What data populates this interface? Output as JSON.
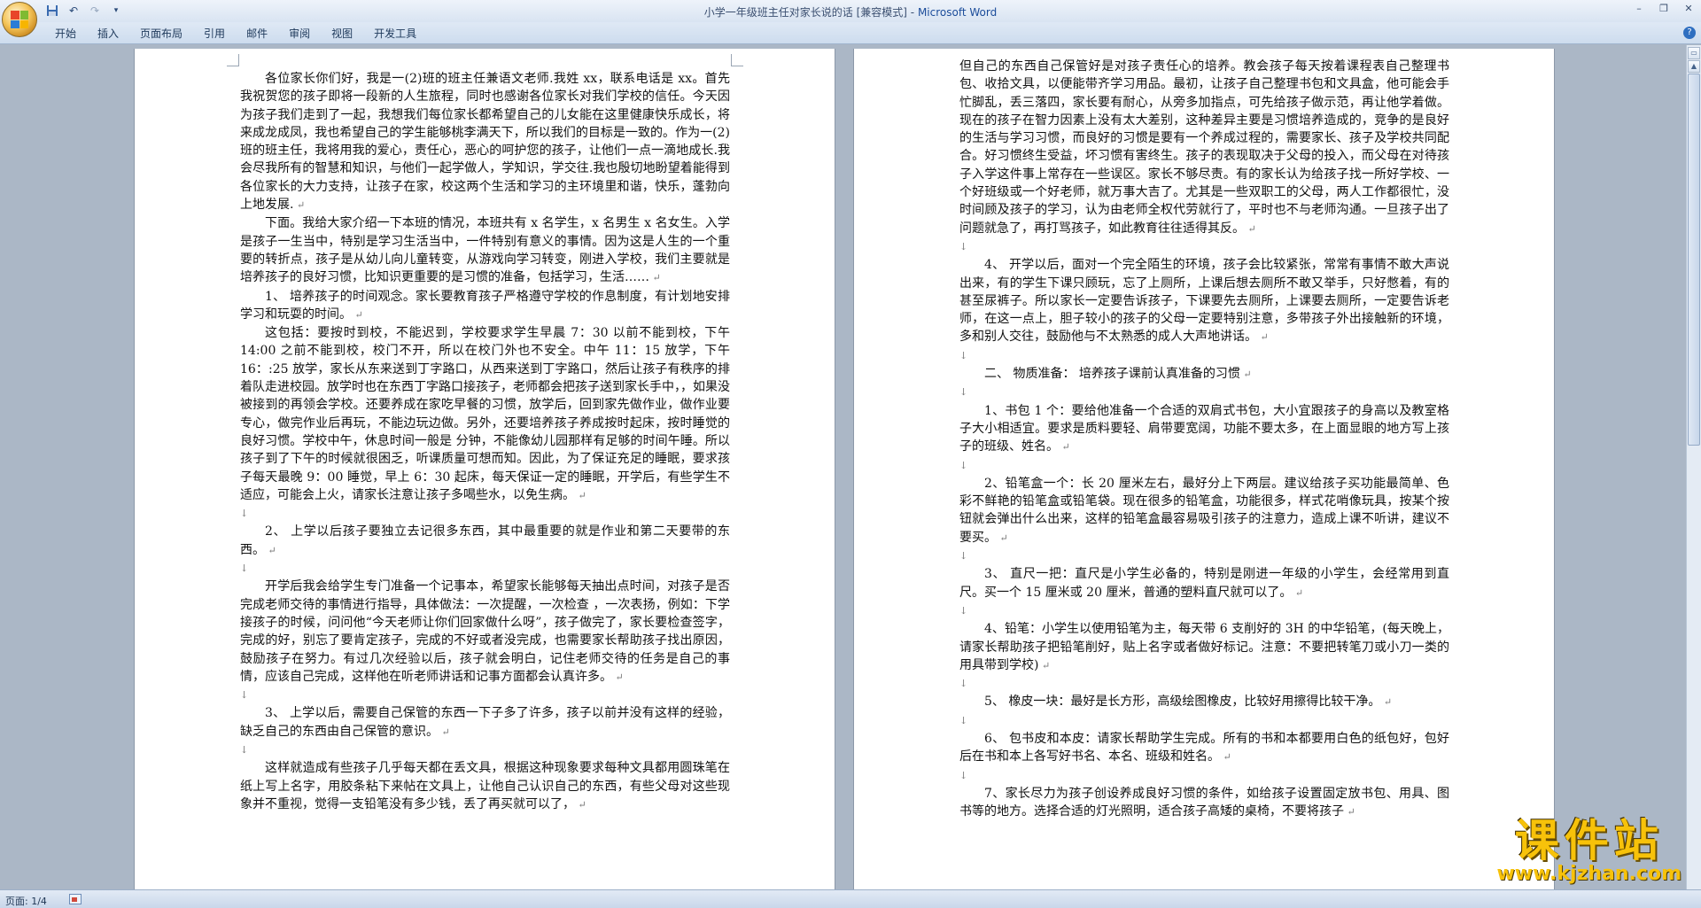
{
  "window": {
    "document_title": "小学一年级班主任对家长说的话 [兼容模式]",
    "separator": " - ",
    "app_name": "Microsoft Word"
  },
  "ribbon": {
    "tabs": [
      "开始",
      "插入",
      "页面布局",
      "引用",
      "邮件",
      "审阅",
      "视图",
      "开发工具"
    ]
  },
  "page1": {
    "paragraphs": [
      {
        "indent": true,
        "text": "各位家长你们好，我是一(2)班的班主任兼语文老师.我姓 xx，联系电话是 xx。首先我祝贺您的孩子即将一段新的人生旅程，同时也感谢各位家长对我们学校的信任。今天因为孩子我们走到了一起，我想我们每位家长都希望自己的儿女能在这里健康快乐成长，将来成龙成凤，我也希望自己的学生能够桃李满天下，所以我们的目标是一致的。作为一(2)班的班主任，我将用我的爱心，责任心，恶心的呵护您的孩子，让他们一点一滴地成长.我会尽我所有的智慧和知识，与他们一起学做人，学知识，学交往.我也殷切地盼望着能得到各位家长的大力支持，让孩子在家，校这两个生活和学习的主环境里和谐，快乐，蓬勃向上地发展."
      },
      {
        "indent": true,
        "text": "下面。我给大家介绍一下本班的情况，本班共有 x 名学生，x 名男生 x 名女生。入学是孩子一生当中，特别是学习生活当中，一件特别有意义的事情。因为这是人生的一个重要的转折点，孩子是从幼儿向儿童转变，从游戏向学习转变，刚进入学校，我们主要就是培养孩子的良好习惯，比知识更重要的是习惯的准备，包括学习，生活……"
      },
      {
        "indent": true,
        "text": "1、 培养孩子的时间观念。家长要教育孩子严格遵守学校的作息制度，有计划地安排学习和玩耍的时间。"
      },
      {
        "indent": true,
        "text": "这包括：要按时到校，不能迟到，学校要求学生早晨 7：30 以前不能到校，下午 14:00 之前不能到校，校门不开，所以在校门外也不安全。中午 11：15 放学，下午 16：:25 放学，家长从东来送到丁字路口，从西来送到丁字路口，然后让孩子有秩序的排着队走进校园。放学时也在东西丁字路口接孩子，老师都会把孩子送到家长手中，，如果没被接到的再领会学校。还要养成在家吃早餐的习惯，放学后，回到家先做作业，做作业要专心，做完作业后再玩，不能边玩边做。另外，还要培养孩子养成按时起床，按时睡觉的良好习惯。学校中午，休息时间一般是  分钟，不能像幼儿园那样有足够的时间午睡。所以孩子到了下午的时候就很困乏，听课质量可想而知。因此，为了保证充足的睡眠，要求孩子每天最晚 9：00 睡觉，早上 6：30 起床，每天保证一定的睡眠，开学后，有些学生不适应，可能会上火，请家长注意让孩子多喝些水，以免生病。"
      },
      {
        "blank": true
      },
      {
        "indent": true,
        "text": "2、 上学以后孩子要独立去记很多东西，其中最重要的就是作业和第二天要带的东西。"
      },
      {
        "blank": true
      },
      {
        "indent": true,
        "text": "开学后我会给学生专门准备一个记事本，希望家长能够每天抽出点时间，对孩子是否完成老师交待的事情进行指导，具体做法：一次提醒，一次检查  ，一次表扬，例如：下学接孩子的时候，问问他“今天老师让你们回家做什么呀”，孩子做完了，家长要检查签字，完成的好，别忘了要肯定孩子，完成的不好或者没完成，也需要家长帮助孩子找出原因，鼓励孩子在努力。有过几次经验以后，孩子就会明白，记住老师交待的任务是自己的事情，应该自己完成，这样他在听老师讲话和记事方面都会认真许多。"
      },
      {
        "blank": true
      },
      {
        "indent": true,
        "text": "3、 上学以后，需要自己保管的东西一下子多了许多，孩子以前并没有这样的经验，缺乏自己的东西由自己保管的意识。"
      },
      {
        "blank": true
      },
      {
        "indent": true,
        "text": "这样就造成有些孩子几乎每天都在丢文具，根据这种现象要求每种文具都用圆珠笔在纸上写上名字，用胶条粘下来帖在文具上，让他自己认识自己的东西，有些父母对这些现象并不重视，觉得一支铅笔没有多少钱，丢了再买就可以了，"
      }
    ]
  },
  "page2": {
    "paragraphs": [
      {
        "indent": false,
        "text": "但自己的东西自己保管好是对孩子责任心的培养。教会孩子每天按着课程表自己整理书包、收拾文具，以便能带齐学习用品。最初，让孩子自己整理书包和文具盒，他可能会手忙脚乱，丢三落四，家长要有耐心，从旁多加指点，可先给孩子做示范，再让他学着做。现在的孩子在智力因素上没有太大差别，这种差异主要是习惯培养造成的，竞争的是良好的生活与学习习惯，而良好的习惯是要有一个养成过程的，需要家长、孩子及学校共同配合。好习惯终生受益，坏习惯有害终生。孩子的表现取决于父母的投入，而父母在对待孩子入学这件事上常存在一些误区。家长不够尽责。有的家长认为给孩子找一所好学校、一个好班级或一个好老师，就万事大吉了。尤其是一些双职工的父母，两人工作都很忙，没时间顾及孩子的学习，认为由老师全权代劳就行了，平时也不与老师沟通。一旦孩子出了问题就急了，再打骂孩子，如此教育往往适得其反。"
      },
      {
        "blank": true
      },
      {
        "indent": true,
        "text": "4、 开学以后，面对一个完全陌生的环境，孩子会比较紧张，常常有事情不敢大声说出来，有的学生下课只顾玩，忘了上厕所，上课后想去厕所不敢又举手，只好憋着，有的甚至尿裤子。所以家长一定要告诉孩子，下课要先去厕所，上课要去厕所，一定要告诉老师，在这一点上，胆子较小的孩子的父母一定要特别注意，多带孩子外出接触新的环境，多和别人交往，鼓励他与不太熟悉的成人大声地讲话。"
      },
      {
        "blank": true
      },
      {
        "indent": true,
        "text": "二、 物质准备：  培养孩子课前认真准备的习惯"
      },
      {
        "blank": true
      },
      {
        "indent": true,
        "text": "1、书包 1 个：要给他准备一个合适的双肩式书包，大小宜跟孩子的身高以及教室格子大小相适宜。要求是质料要轻、肩带要宽阔，功能不要太多，在上面显眼的地方写上孩子的班级、姓名。"
      },
      {
        "blank": true
      },
      {
        "indent": true,
        "text": "2、铅笔盒一个：长 20 厘米左右，最好分上下两层。建议给孩子买功能最简单、色彩不鲜艳的铅笔盒或铅笔袋。现在很多的铅笔盒，功能很多，样式花哨像玩具，按某个按钮就会弹出什么出来，这样的铅笔盒最容易吸引孩子的注意力，造成上课不听讲，建议不要买。"
      },
      {
        "blank": true
      },
      {
        "indent": true,
        "text": "3、 直尺一把：直尺是小学生必备的，特别是刚进一年级的小学生，会经常用到直尺。买一个 15 厘米或 20 厘米，普通的塑料直尺就可以了。"
      },
      {
        "blank": true
      },
      {
        "indent": true,
        "text": "4、铅笔：小学生以使用铅笔为主，每天带 6 支削好的 3H 的中华铅笔，(每天晚上，请家长帮助孩子把铅笔削好，贴上名字或者做好标记。注意：不要把转笔刀或小刀一类的用具带到学校)"
      },
      {
        "blank": true
      },
      {
        "indent": true,
        "text": "5、 橡皮一块：最好是长方形，高级绘图橡皮，比较好用擦得比较干净。"
      },
      {
        "blank": true
      },
      {
        "indent": true,
        "text": "6、 包书皮和本皮：请家长帮助学生完成。所有的书和本都要用白色的纸包好，包好后在书和本上各写好书名、本名、班级和姓名。"
      },
      {
        "blank": true
      },
      {
        "indent": true,
        "text": "7、家长尽力为孩子创设养成良好习惯的条件，如给孩子设置固定放书包、用具、图书等的地方。选择合适的灯光照明，适合孩子高矮的桌椅，不要将孩子"
      }
    ]
  },
  "status": {
    "page_indicator": "页面: 1/4"
  },
  "watermark": {
    "title": "课件站",
    "url": "www.kjzhan.com"
  },
  "icons": {
    "office_button": "office-logo-icon",
    "save": "save-icon",
    "undo": "undo-icon",
    "redo": "redo-icon",
    "customize": "customize-qat-icon",
    "help": "help-icon"
  }
}
